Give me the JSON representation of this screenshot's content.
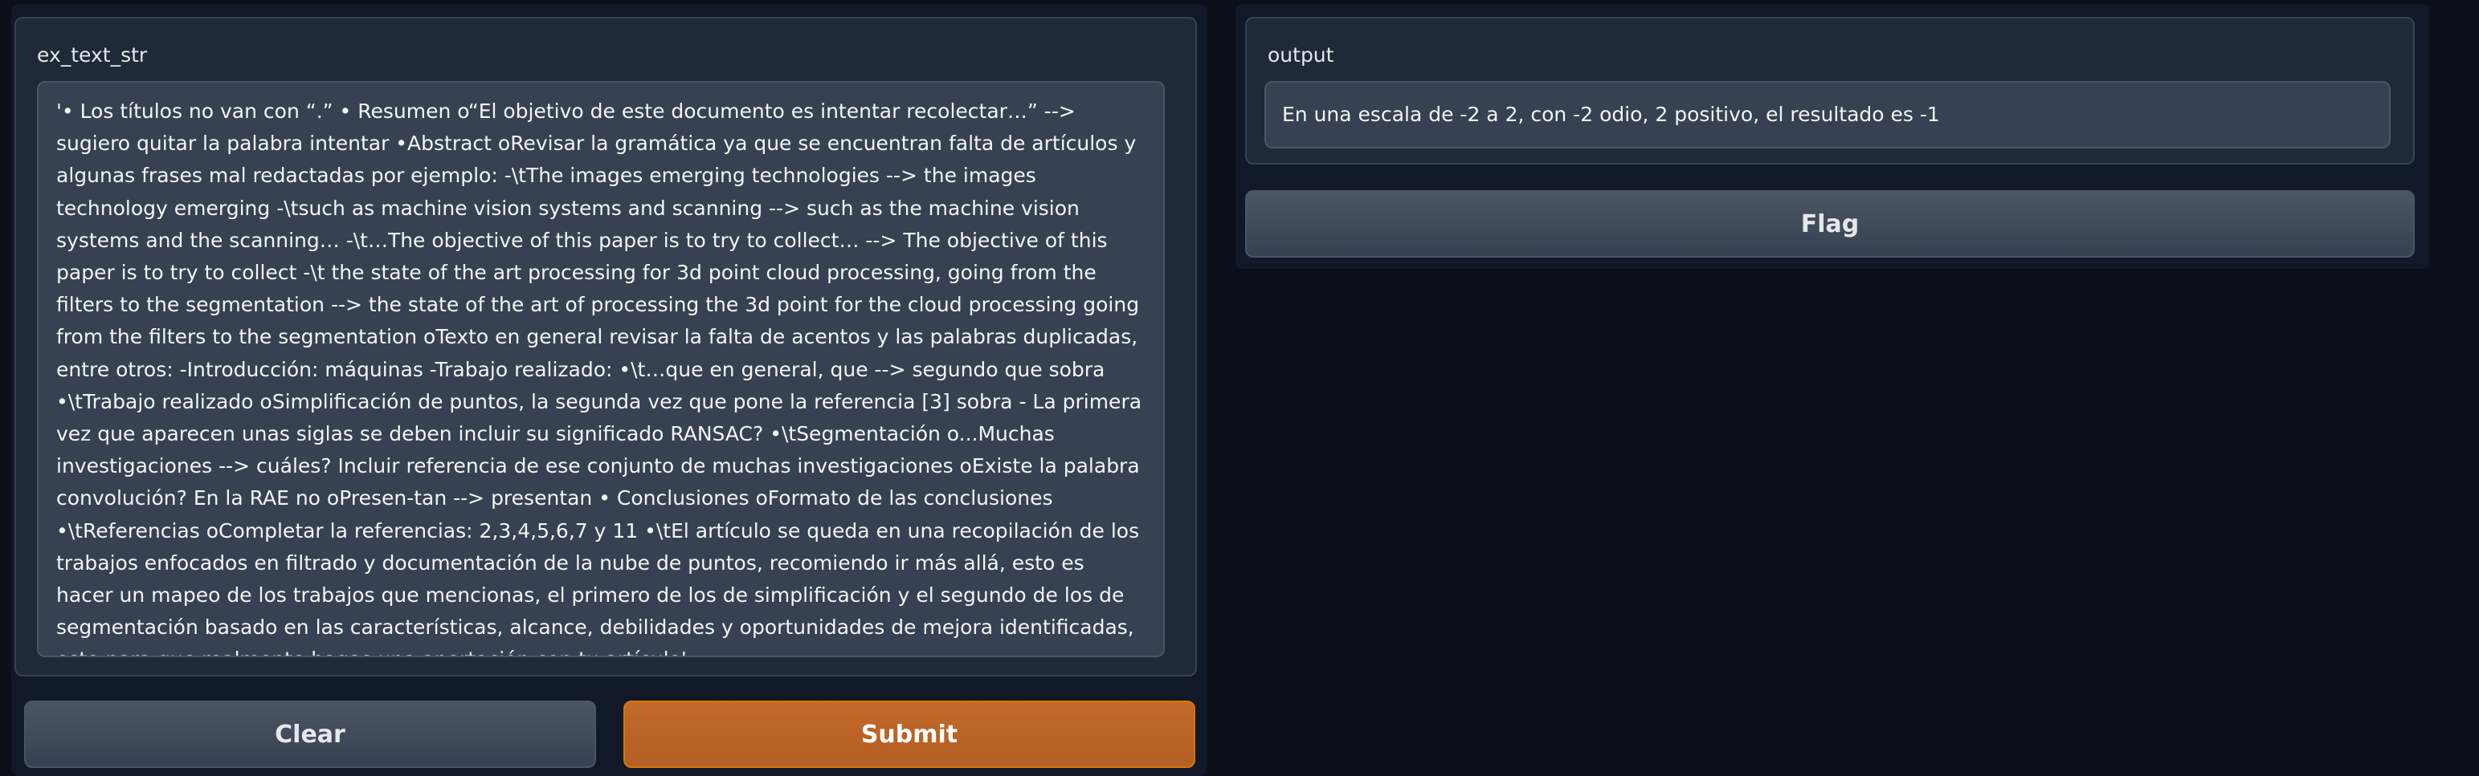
{
  "input": {
    "label": "ex_text_str",
    "value": "'• Los títulos no van con “.” • Resumen   o“El objetivo de este documento es intentar recolectar…” --> sugiero quitar la palabra intentar •Abstract   oRevisar la gramática ya que se encuentran falta de artículos y algunas frases mal redactadas por ejemplo:    -\\tThe images emerging technologies -->  the images technology emerging    -\\tsuch as machine vision systems and scanning --> such as the machine vision systems and the scanning…    -\\t…The objective of this paper is to try to collect… --> The objective of this paper is to try to collect    -\\t the state of the art processing for 3d point cloud processing, going from the filters to the segmentation --> the state of the art of  processing the 3d point for the cloud processing going from the filters to the segmentation   oTexto en general revisar la falta de acentos y las palabras duplicadas, entre otros:    -Introducción: máquinas    -Trabajo realizado:      •\\t…que en general, que --> segundo que sobra      •\\tTrabajo realizado    oSimplificación de puntos, la segunda vez que pone la referencia [3] sobra    - La primera vez que aparecen unas siglas se deben incluir su significado RANSAC?      •\\tSegmentación o...Muchas investigaciones --> cuáles? Incluir referencia de ese conjunto de muchas investigaciones   oExiste la palabra convolución? En la RAE no   oPresen-tan --> presentan      • Conclusiones   oFormato de las conclusiones •\\tReferencias   oCompletar la referencias: 2,3,4,5,6,7 y 11      •\\tEl artículo se queda en una recopilación de los trabajos enfocados en filtrado y documentación de la nube de puntos, recomiendo ir más allá, esto es hacer un mapeo de los trabajos que mencionas, el primero de los de simplificación y el segundo de los de segmentación basado en las características, alcance, debilidades y oportunidades de mejora identificadas, esto para que realmente hagas una aportación con tu artículo'"
  },
  "output": {
    "label": "output",
    "value": "En una escala de -2 a 2, con -2 odio, 2 positivo, el resultado es -1"
  },
  "buttons": {
    "clear": "Clear",
    "submit": "Submit",
    "flag": "Flag"
  },
  "colors": {
    "background": "#0b0f19",
    "panel": "#1f2937",
    "input": "#374151",
    "primary": "#c2692a"
  }
}
